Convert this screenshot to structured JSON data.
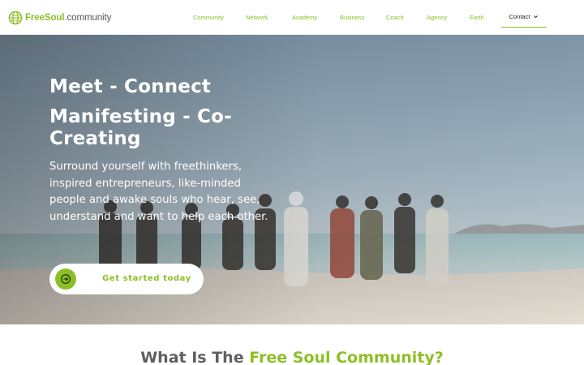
{
  "header": {
    "logo": {
      "brand": "FreeSoul",
      "suffix": ".community"
    },
    "nav": [
      {
        "label": "Community",
        "id": "community"
      },
      {
        "label": "Network",
        "id": "network"
      },
      {
        "label": "Academy",
        "id": "academy"
      },
      {
        "label": "Business",
        "id": "business"
      },
      {
        "label": "Coach",
        "id": "coach"
      },
      {
        "label": "Agency",
        "id": "agency"
      },
      {
        "label": "Earth",
        "id": "earth"
      }
    ],
    "contact": {
      "label": "Contact",
      "icon": "chevron-down-icon"
    }
  },
  "hero": {
    "title_line1": "Meet - Connect",
    "title_line2": "Manifesting - Co-Creating",
    "body": "Surround yourself with freethinkers, inspired entrepreneurs, like-minded people and awake souls who hear, see, understand and want to help each other.",
    "cta": {
      "label": "Get started today",
      "icon": "arrow-circle-right-icon"
    },
    "image_alt": "people on a beach raising hands"
  },
  "section": {
    "title_prefix": "What Is The ",
    "title_accent": "Free Soul Community?"
  },
  "colors": {
    "accent": "#8cbf26",
    "text_dark": "#222222",
    "text_grey": "#5f5f5f"
  }
}
